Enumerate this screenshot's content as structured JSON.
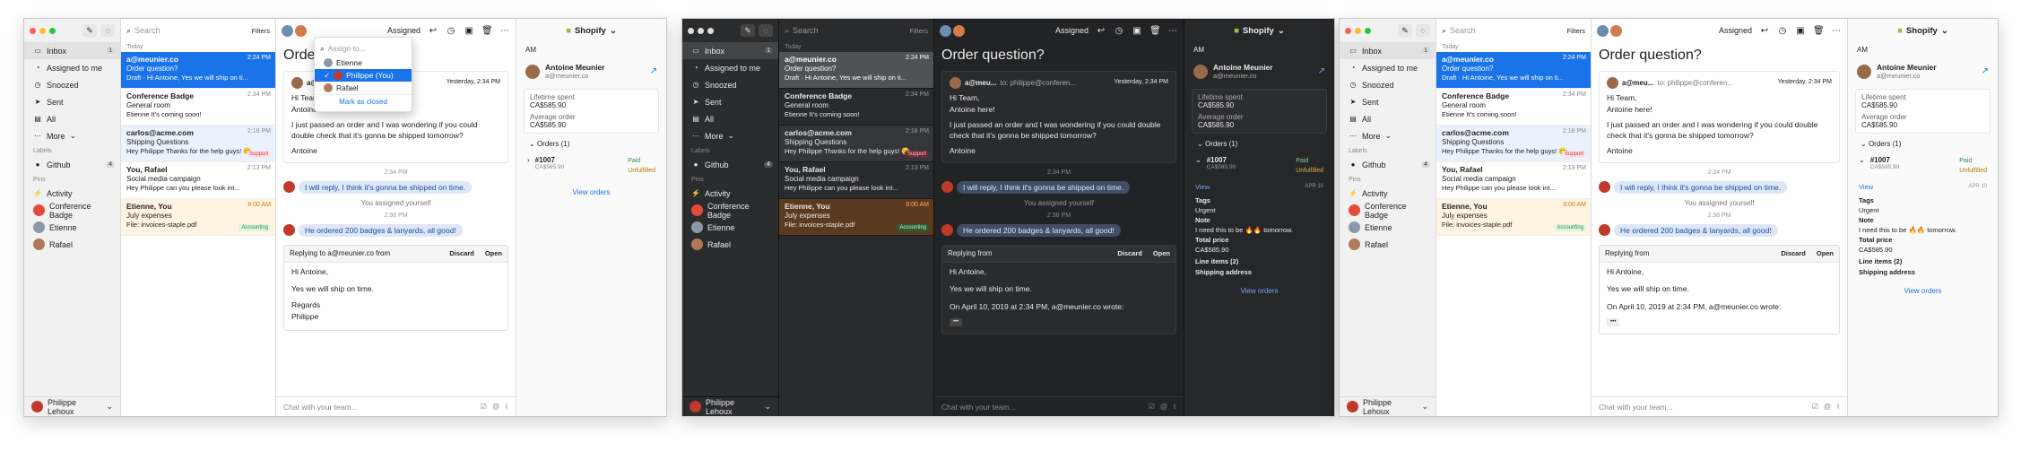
{
  "colors": {
    "accent": "#1a73e8",
    "red": "#ff5f57",
    "yellow": "#ffbd2e",
    "green": "#28c840",
    "shopify": "#95bf47"
  },
  "nav": {
    "inbox": "Inbox",
    "inbox_count": "1",
    "assigned": "Assigned to me",
    "snoozed": "Snoozed",
    "sent": "Sent",
    "all": "All",
    "more": "More",
    "labels": "Labels",
    "github": "Github",
    "github_count": "4",
    "pins": "Pins",
    "activity": "Activity",
    "conference": "Conference Badge",
    "etienne": "Etienne",
    "rafael": "Rafael",
    "user": "Philippe Lehoux"
  },
  "list": {
    "search_placeholder": "Search",
    "filters": "Filters",
    "today": "Today",
    "items": [
      {
        "from": "a@meunier.co",
        "time": "2:24 PM",
        "subject": "Order question?",
        "preview": "Draft · Hi Antoine, Yes we will ship on ti..."
      },
      {
        "from": "Conference Badge",
        "time": "2:34 PM",
        "subject": "General room",
        "preview": "Etienne It's coming soon!"
      },
      {
        "from": "carlos@acme.com",
        "time": "2:18 PM",
        "subject": "Shipping Questions",
        "preview": "Hey Philippe Thanks for the help guys! 😊",
        "tag": "Support"
      },
      {
        "from": "You, Rafael",
        "time": "2:13 PM",
        "subject": "Social media campaign",
        "preview": "Hey Philippe can you please look int..."
      },
      {
        "from": "Etienne, You",
        "time": "8:00 AM",
        "subject": "July expenses",
        "preview": "File: invoices-staple.pdf",
        "tag": "Accounting"
      }
    ]
  },
  "conv": {
    "assigned_label": "Assigned",
    "subject": "Order question?",
    "email_from": "a@meu...",
    "email_to": "to: philippe@conferen...",
    "email_date": "Yesterday, 2:34 PM",
    "greeting": "Hi Team,",
    "name_line": "Antoine here!",
    "body": "I just passed an order and I was wondering if you could double check that it's gonna be shipped tomorrow?",
    "signature": "Antoine",
    "t1": "2:34 PM",
    "comment1": "I will reply, I think it's gonna be shipped on time.",
    "sys1": "You assigned yourself",
    "t2": "2:38 PM",
    "comment2": "He ordered 200 badges & lanyards, all good!",
    "reply_header": "Replying to a@meunier.co from",
    "reply_header_short": "Replying from",
    "discard": "Discard",
    "open": "Open",
    "reply_hi": "Hi Antoine,",
    "reply_body": "Yes we will ship on time.",
    "regards": "Regards",
    "regards_name": "Philippe",
    "quote": "On April 10, 2019 at 2:34 PM, a@meunier.co wrote:",
    "ellipsis": "•••",
    "composer": "Chat with your team..."
  },
  "dropdown": {
    "placeholder": "Assign to...",
    "options": [
      "Etienne",
      "Philippe (You)",
      "Rafael"
    ],
    "mark": "Mark as closed"
  },
  "ctx": {
    "title": "Shopify",
    "tab": "AM",
    "name": "Antoine Meunier",
    "email": "a@meunier.co",
    "lifetime_label": "Lifetime spent",
    "lifetime": "CA$585.90",
    "avg_label": "Average order",
    "avg": "CA$585.90",
    "orders_label": "Orders (1)",
    "order_no": "#1007",
    "order_amt": "CA$585.90",
    "paid": "Paid",
    "unfulfilled": "Unfulfilled",
    "view": "View",
    "date": "APR 10",
    "tags_label": "Tags",
    "tags": "Urgent",
    "note_label": "Note",
    "note": "I need this to be 🔥🔥 tomorrow.",
    "total_label": "Total price",
    "total": "CA$585.90",
    "line_items": "Line items (2)",
    "shipping": "Shipping address",
    "view_orders": "View orders"
  }
}
